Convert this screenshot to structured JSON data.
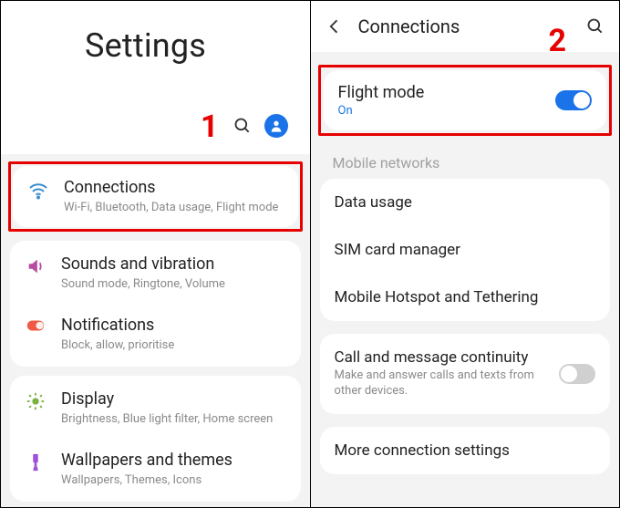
{
  "annotations": {
    "step1": "1",
    "step2": "2"
  },
  "left": {
    "title": "Settings",
    "items": [
      {
        "title": "Connections",
        "sub": "Wi-Fi, Bluetooth, Data usage, Flight mode",
        "icon": "wifi",
        "color": "#3b8ed0"
      },
      {
        "title": "Sounds and vibration",
        "sub": "Sound mode, Ringtone, Volume",
        "icon": "speaker",
        "color": "#b84ca3"
      },
      {
        "title": "Notifications",
        "sub": "Block, allow, prioritise",
        "icon": "notif",
        "color": "#f05a45"
      },
      {
        "title": "Display",
        "sub": "Brightness, Blue light filter, Home screen",
        "icon": "sun",
        "color": "#7bb241"
      },
      {
        "title": "Wallpapers and themes",
        "sub": "Wallpapers, Themes, Icons",
        "icon": "brush",
        "color": "#a050d8"
      }
    ]
  },
  "right": {
    "title": "Connections",
    "flight": {
      "title": "Flight mode",
      "status": "On",
      "toggle": true
    },
    "mobile_label": "Mobile networks",
    "group": [
      {
        "title": "Data usage"
      },
      {
        "title": "SIM card manager"
      },
      {
        "title": "Mobile Hotspot and Tethering"
      }
    ],
    "continuity": {
      "title": "Call and message continuity",
      "sub": "Make and answer calls and texts from other devices.",
      "toggle": false
    },
    "more": {
      "title": "More connection settings"
    }
  }
}
